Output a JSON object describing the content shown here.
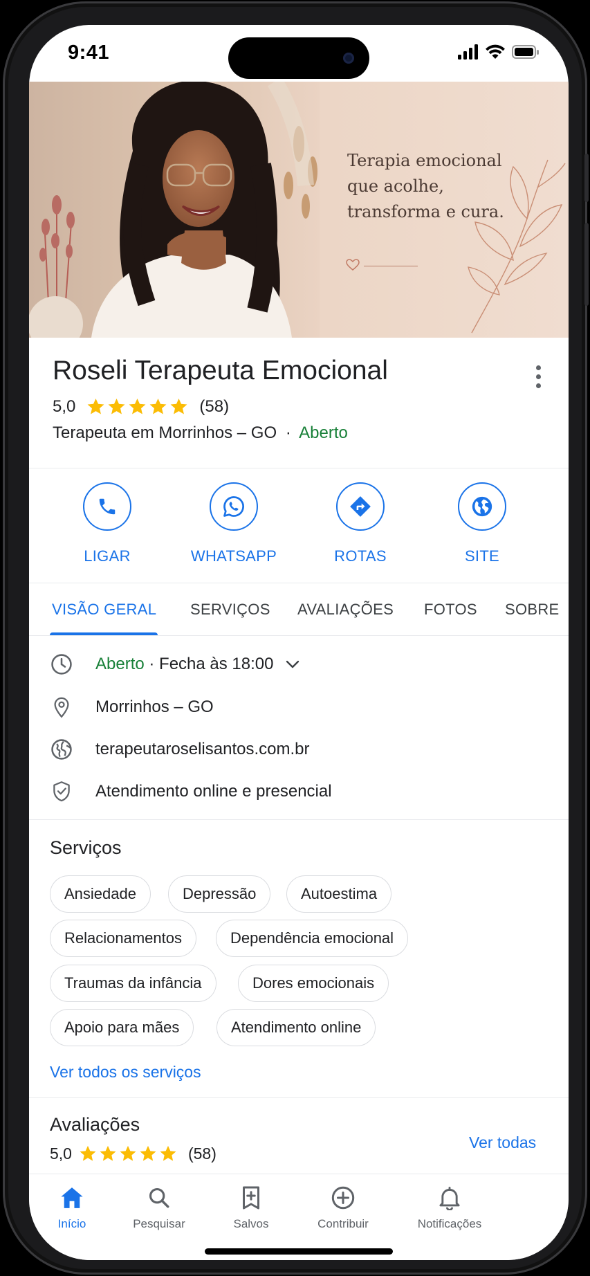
{
  "status_bar": {
    "time": "9:41"
  },
  "hero": {
    "tagline": "Terapia emocional que acolhe, transforma e cura."
  },
  "business": {
    "name": "Roseli Terapeuta Emocional",
    "rating": "5,0",
    "stars": 5,
    "review_count": "(58)",
    "category": "Terapeuta em Morrinhos – GO",
    "separator": "·",
    "open_status": "Aberto"
  },
  "actions": [
    {
      "label": "LIGAR",
      "icon": "phone-icon"
    },
    {
      "label": "WHATSAPP",
      "icon": "whatsapp-icon"
    },
    {
      "label": "ROTAS",
      "icon": "directions-icon"
    },
    {
      "label": "SITE",
      "icon": "globe-icon"
    }
  ],
  "tabs": [
    {
      "label": "VISÃO GERAL",
      "active": true
    },
    {
      "label": "SERVIÇOS"
    },
    {
      "label": "AVALIAÇÕES"
    },
    {
      "label": "FOTOS"
    },
    {
      "label": "SOBRE"
    }
  ],
  "info": {
    "hours_status": "Aberto",
    "hours_detail": " · Fecha às 18:00",
    "location": "Morrinhos – GO",
    "website": "terapeutaroselisantos.com.br",
    "service_mode": "Atendimento online e presencial"
  },
  "services": {
    "title": "Serviços",
    "chips": [
      "Ansiedade",
      "Depressão",
      "Autoestima",
      "Relacionamentos",
      "Dependência emocional",
      "Traumas da infância",
      "Dores emocionais",
      "Apoio para mães",
      "Atendimento online"
    ],
    "see_all": "Ver todos os serviços"
  },
  "reviews": {
    "title": "Avaliações",
    "rating": "5,0",
    "count": "(58)",
    "see_all": "Ver todas"
  },
  "bottom_nav": [
    {
      "label": "Início",
      "icon": "home-icon",
      "active": true
    },
    {
      "label": "Pesquisar",
      "icon": "search-icon"
    },
    {
      "label": "Salvos",
      "icon": "bookmark-icon"
    },
    {
      "label": "Contribuir",
      "icon": "add-circle-icon"
    },
    {
      "label": "Notificações",
      "icon": "bell-icon"
    }
  ],
  "colors": {
    "accent": "#1a73e8",
    "open": "#188038",
    "star": "#fbbc04"
  }
}
